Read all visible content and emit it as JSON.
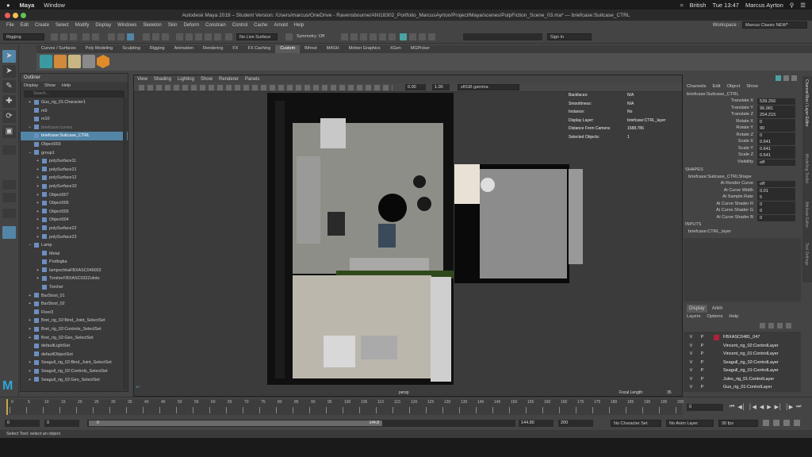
{
  "macbar": {
    "app": "Maya",
    "menu": [
      "Window"
    ],
    "lang": "British",
    "time": "Tue 13:47",
    "user": "Marcus Ayrton"
  },
  "titlebar": {
    "title": "Autodesk Maya 2018 – Student Version: /Users/marcus/OneDrive - Ravensbourne/ANI18302_Portfolio_MarcusAyrton/Project/Maya/scenes/PulpFiction_Scene_03.ma* — briefcase:Suitcase_CTRL"
  },
  "menubar": {
    "items": [
      "File",
      "Edit",
      "Create",
      "Select",
      "Modify",
      "Display",
      "Windows",
      "Skeleton",
      "Skin",
      "Deform",
      "Constrain",
      "Control",
      "Cache",
      "Arnold",
      "Help"
    ],
    "workspace_label": "Workspace :",
    "workspace_value": "Marcus Classic NEW*"
  },
  "statusline": {
    "mode": "Rigging",
    "live_surface": "No Live Surface",
    "symmetry": "Symmetry: Off",
    "sign_in": "Sign In"
  },
  "shelf": {
    "tabs": [
      "Curves / Surfaces",
      "Poly Modeling",
      "Sculpting",
      "Rigging",
      "Animation",
      "Rendering",
      "FX",
      "FX Caching",
      "Custom",
      "Bifrost",
      "MASH",
      "Motion Graphics",
      "XGen",
      "MGPicker"
    ],
    "active": "Custom"
  },
  "outliner": {
    "title": "Outliner",
    "menu": [
      "Display",
      "Show",
      "Help"
    ],
    "search_placeholder": "Search...",
    "items": [
      {
        "label": "Gus_rig_01:Character1",
        "indent": 1,
        "exp": "+"
      },
      {
        "label": "m9",
        "indent": 1,
        "exp": ""
      },
      {
        "label": "m10",
        "indent": 1,
        "exp": ""
      },
      {
        "label": "briefcase:curves",
        "indent": 1,
        "exp": "+",
        "dim": true
      },
      {
        "label": "briefcase:Suitcase_CTRL",
        "indent": 1,
        "exp": "",
        "sel": true
      },
      {
        "label": "Object003",
        "indent": 1,
        "exp": ""
      },
      {
        "label": "group1",
        "indent": 1,
        "exp": "−"
      },
      {
        "label": "polySurface11",
        "indent": 2,
        "exp": "+"
      },
      {
        "label": "polySurface21",
        "indent": 2,
        "exp": "+"
      },
      {
        "label": "polySurface12",
        "indent": 2,
        "exp": "+"
      },
      {
        "label": "polySurface10",
        "indent": 2,
        "exp": "+"
      },
      {
        "label": "Object007",
        "indent": 2,
        "exp": "+"
      },
      {
        "label": "Object006",
        "indent": 2,
        "exp": "+"
      },
      {
        "label": "Object005",
        "indent": 2,
        "exp": "+"
      },
      {
        "label": "Object004",
        "indent": 2,
        "exp": "+"
      },
      {
        "label": "polySurface22",
        "indent": 2,
        "exp": "+"
      },
      {
        "label": "polySurface23",
        "indent": 2,
        "exp": "+"
      },
      {
        "label": "Lamp",
        "indent": 1,
        "exp": "−"
      },
      {
        "label": "Metal",
        "indent": 2,
        "exp": ""
      },
      {
        "label": "Podlogka",
        "indent": 2,
        "exp": ""
      },
      {
        "label": "lampochkaFBXASC046002",
        "indent": 2,
        "exp": "+"
      },
      {
        "label": "TorsherFBXASC032Zoloto",
        "indent": 2,
        "exp": "+"
      },
      {
        "label": "Torcher",
        "indent": 2,
        "exp": ""
      },
      {
        "label": "BarStool_01",
        "indent": 1,
        "exp": "+"
      },
      {
        "label": "BarStool_02",
        "indent": 1,
        "exp": "+"
      },
      {
        "label": "Floor3",
        "indent": 1,
        "exp": ""
      },
      {
        "label": "Bret_rig_02:Bind_Joint_SelectSet",
        "indent": 1,
        "exp": "+"
      },
      {
        "label": "Bret_rig_02:Controls_SelectSet",
        "indent": 1,
        "exp": "+"
      },
      {
        "label": "Bret_rig_02:Geo_SelectSet",
        "indent": 1,
        "exp": "+"
      },
      {
        "label": "defaultLightSet",
        "indent": 1,
        "exp": ""
      },
      {
        "label": "defaultObjectSet",
        "indent": 1,
        "exp": ""
      },
      {
        "label": "Seagull_rig_02:Bind_Joint_SelectSet",
        "indent": 1,
        "exp": "+"
      },
      {
        "label": "Seagull_rig_02:Controls_SelectSet",
        "indent": 1,
        "exp": "+"
      },
      {
        "label": "Seagull_rig_02:Geo_SelectSet",
        "indent": 1,
        "exp": "+"
      }
    ]
  },
  "viewport": {
    "menu": [
      "View",
      "Shading",
      "Lighting",
      "Show",
      "Renderer",
      "Panels"
    ],
    "exposure": "0.00",
    "gamma": "1.00",
    "colorspace": "sRGB gamma",
    "camera": "persp",
    "focal_label": "Focal Length:",
    "focal_value": "35",
    "hud": [
      {
        "k": "Backfaces:",
        "v": "N/A"
      },
      {
        "k": "Smoothness:",
        "v": "N/A"
      },
      {
        "k": "Instance:",
        "v": "No"
      },
      {
        "k": "Display Layer:",
        "v": "briefcase:CTRL_layer"
      },
      {
        "k": "Distance From Camera:",
        "v": "1588.786"
      },
      {
        "k": "Selected Objects:",
        "v": "1"
      }
    ]
  },
  "channelbox": {
    "menu": [
      "Channels",
      "Edit",
      "Object",
      "Show"
    ],
    "object": "briefcase:Suitcase_CTRL",
    "attrs": [
      {
        "k": "Translate X",
        "v": "539.256"
      },
      {
        "k": "Translate Y",
        "v": "96.981"
      },
      {
        "k": "Translate Z",
        "v": "254.215"
      },
      {
        "k": "Rotate X",
        "v": "0"
      },
      {
        "k": "Rotate Y",
        "v": "90"
      },
      {
        "k": "Rotate Z",
        "v": "0"
      },
      {
        "k": "Scale X",
        "v": "0.641"
      },
      {
        "k": "Scale Y",
        "v": "0.641"
      },
      {
        "k": "Scale Z",
        "v": "0.641"
      },
      {
        "k": "Visibility",
        "v": "off"
      }
    ],
    "shapes_label": "SHAPES",
    "shape_name": "briefcase:Suitcase_CTRLShape",
    "shape_attrs": [
      {
        "k": "Ai Render Curve",
        "v": "off"
      },
      {
        "k": "Ai Curve Width",
        "v": "0.01"
      },
      {
        "k": "Ai Sample Rate",
        "v": "5"
      },
      {
        "k": "Ai Curve Shader R",
        "v": "0"
      },
      {
        "k": "Ai Curve Shader G",
        "v": "0"
      },
      {
        "k": "Ai Curve Shader B",
        "v": "0"
      }
    ],
    "inputs_label": "INPUTS",
    "input_name": "briefcase:CTRL_layer"
  },
  "layers": {
    "tabs": [
      "Display",
      "Anim"
    ],
    "menu": [
      "Layers",
      "Options",
      "Help"
    ],
    "rows": [
      {
        "v": "V",
        "p": "P",
        "name": "FBXASC0481_047",
        "color": "#b0203a"
      },
      {
        "v": "V",
        "p": "P",
        "name": "Vincent_rig_02:ControlLayer",
        "color": "#3a3a3a"
      },
      {
        "v": "V",
        "p": "P",
        "name": "Vincent_rig_01:ControlLayer",
        "color": "#3a3a3a"
      },
      {
        "v": "V",
        "p": "P",
        "name": "Seagull_rig_02:ControlLayer",
        "color": "#3a3a3a"
      },
      {
        "v": "V",
        "p": "P",
        "name": "Seagull_rig_01:ControlLayer",
        "color": "#3a3a3a"
      },
      {
        "v": "V",
        "p": "P",
        "name": "Jules_rig_01:ControlLayer",
        "color": "#3a3a3a"
      },
      {
        "v": "V",
        "p": "P",
        "name": "Gus_rig_01:ControlLayer",
        "color": "#3a3a3a"
      }
    ]
  },
  "timeline": {
    "ticks": [
      "0",
      "5",
      "10",
      "15",
      "20",
      "25",
      "30",
      "35",
      "40",
      "45",
      "50",
      "55",
      "60",
      "65",
      "70",
      "75",
      "80",
      "85",
      "90",
      "95",
      "100",
      "105",
      "110",
      "115",
      "120",
      "125",
      "130",
      "135",
      "140",
      "145",
      "150",
      "155",
      "160",
      "165",
      "170",
      "175",
      "180",
      "185",
      "190",
      "195",
      "200"
    ],
    "current": "0"
  },
  "range": {
    "start": "0",
    "inner_start": "0",
    "range_start": "0",
    "range_end": "144.8",
    "end": "144.80",
    "anim_end": "200",
    "character_set": "No Character Set",
    "anim_layer": "No Anim Layer",
    "fps": "30 fps"
  },
  "helpline": "Select Tool: select an object",
  "side_tabs": [
    "Channel Box / Layer Editor",
    "Modelling Toolkit",
    "Attribute Editor",
    "Tool Settings"
  ]
}
